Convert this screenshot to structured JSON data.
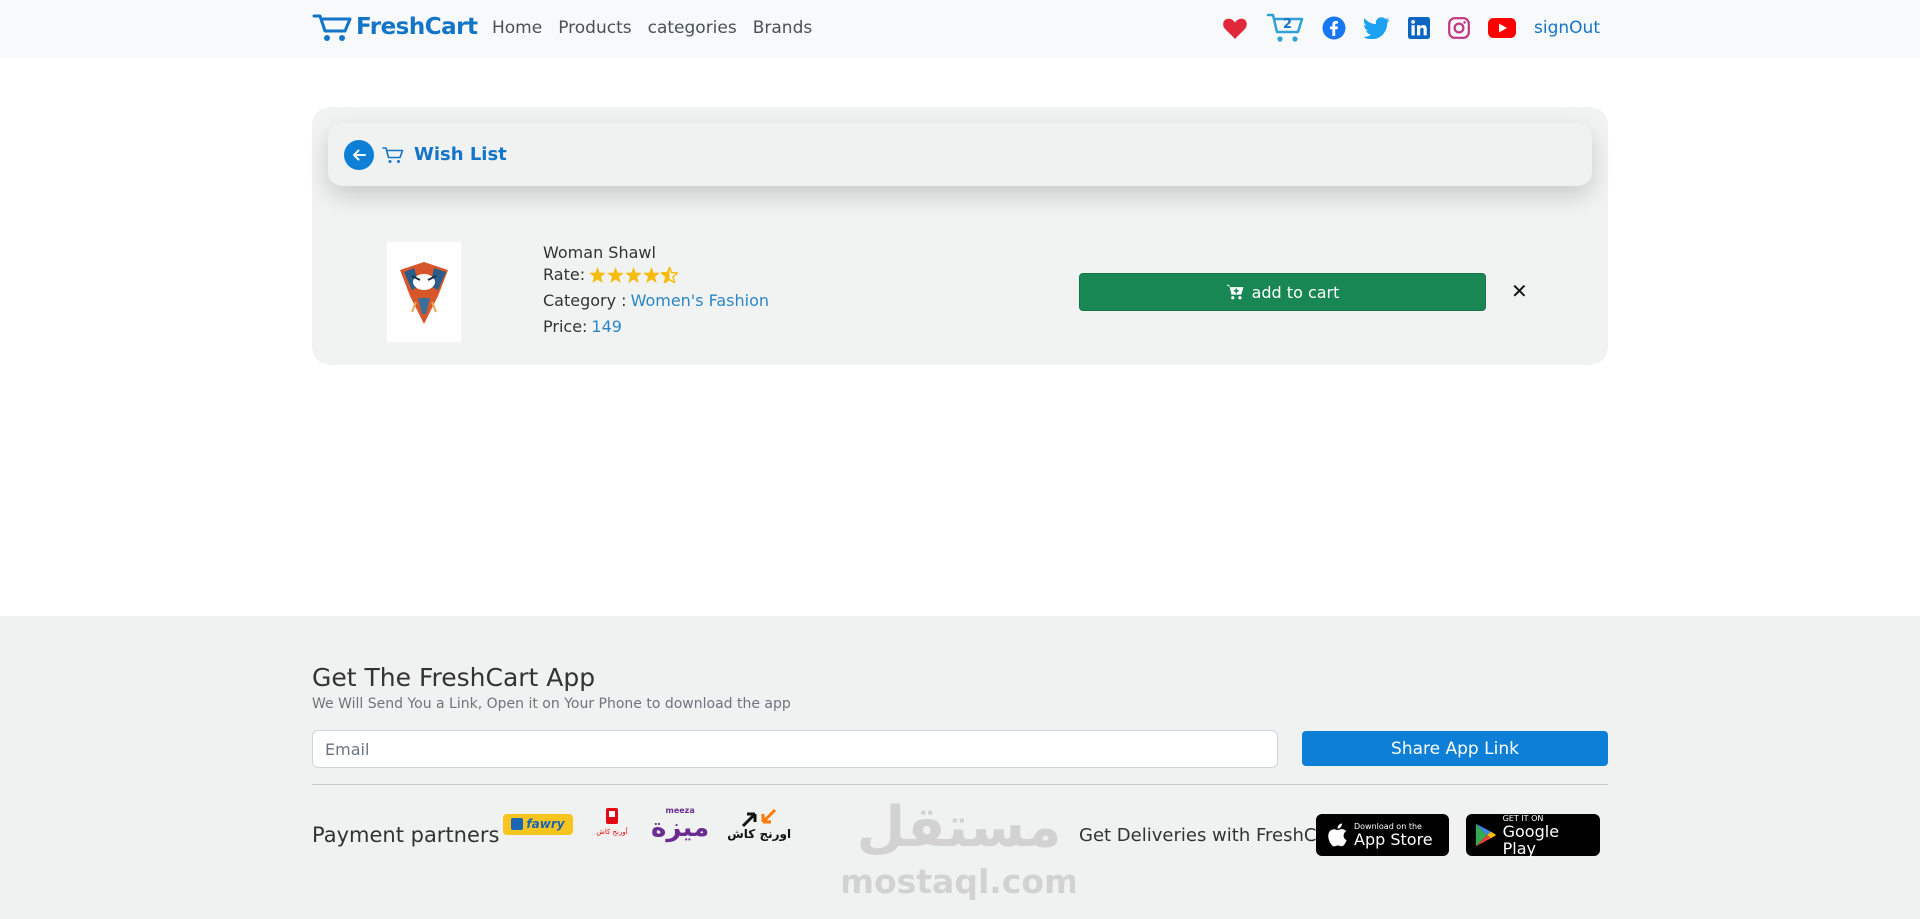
{
  "navbar": {
    "brand": "FreshCart",
    "links": [
      "Home",
      "Products",
      "categories",
      "Brands"
    ],
    "cart_count": "2",
    "signout": "signOut",
    "icons": [
      "heart-icon",
      "cart-icon",
      "facebook-icon",
      "twitter-icon",
      "linkedin-icon",
      "instagram-icon",
      "youtube-icon"
    ],
    "colors": {
      "brand": "#1275c8",
      "heart": "#e0283a",
      "facebook": "#1877f2",
      "twitter": "#1da1f2",
      "linkedin": "#0a66c2",
      "instagram": "#c13584",
      "youtube": "#ff0000"
    }
  },
  "wishlist": {
    "title": "Wish List",
    "items": [
      {
        "name": "Woman Shawl",
        "rate_label": "Rate:",
        "rating": 4.5,
        "category_label": "Category :",
        "category": "Women's Fashion",
        "price_label": "Price:",
        "price": "149",
        "add_label": "add to cart",
        "remove_label": "✕"
      }
    ]
  },
  "footer": {
    "app_title": "Get The FreshCart App",
    "app_subtitle": "We Will Send You a Link, Open it on Your Phone to download the app",
    "email_placeholder": "Email",
    "share_label": "Share App Link",
    "payment_label": "Payment partners",
    "payment_logos": {
      "fawry": "fawry",
      "orange_cash": "أورنج كاش",
      "meeza_small": "meeza",
      "meeza_ar": "ميزة",
      "orange_cash_ar": "اورنج كاش"
    },
    "deliveries_label": "Get Deliveries with FreshCart",
    "app_store": {
      "small": "Download on the",
      "big": "App Store"
    },
    "google_play": {
      "small": "GET IT ON",
      "big": "Google Play"
    },
    "watermark": {
      "arabic": "مستقل",
      "latin": "mostaql.com"
    }
  }
}
